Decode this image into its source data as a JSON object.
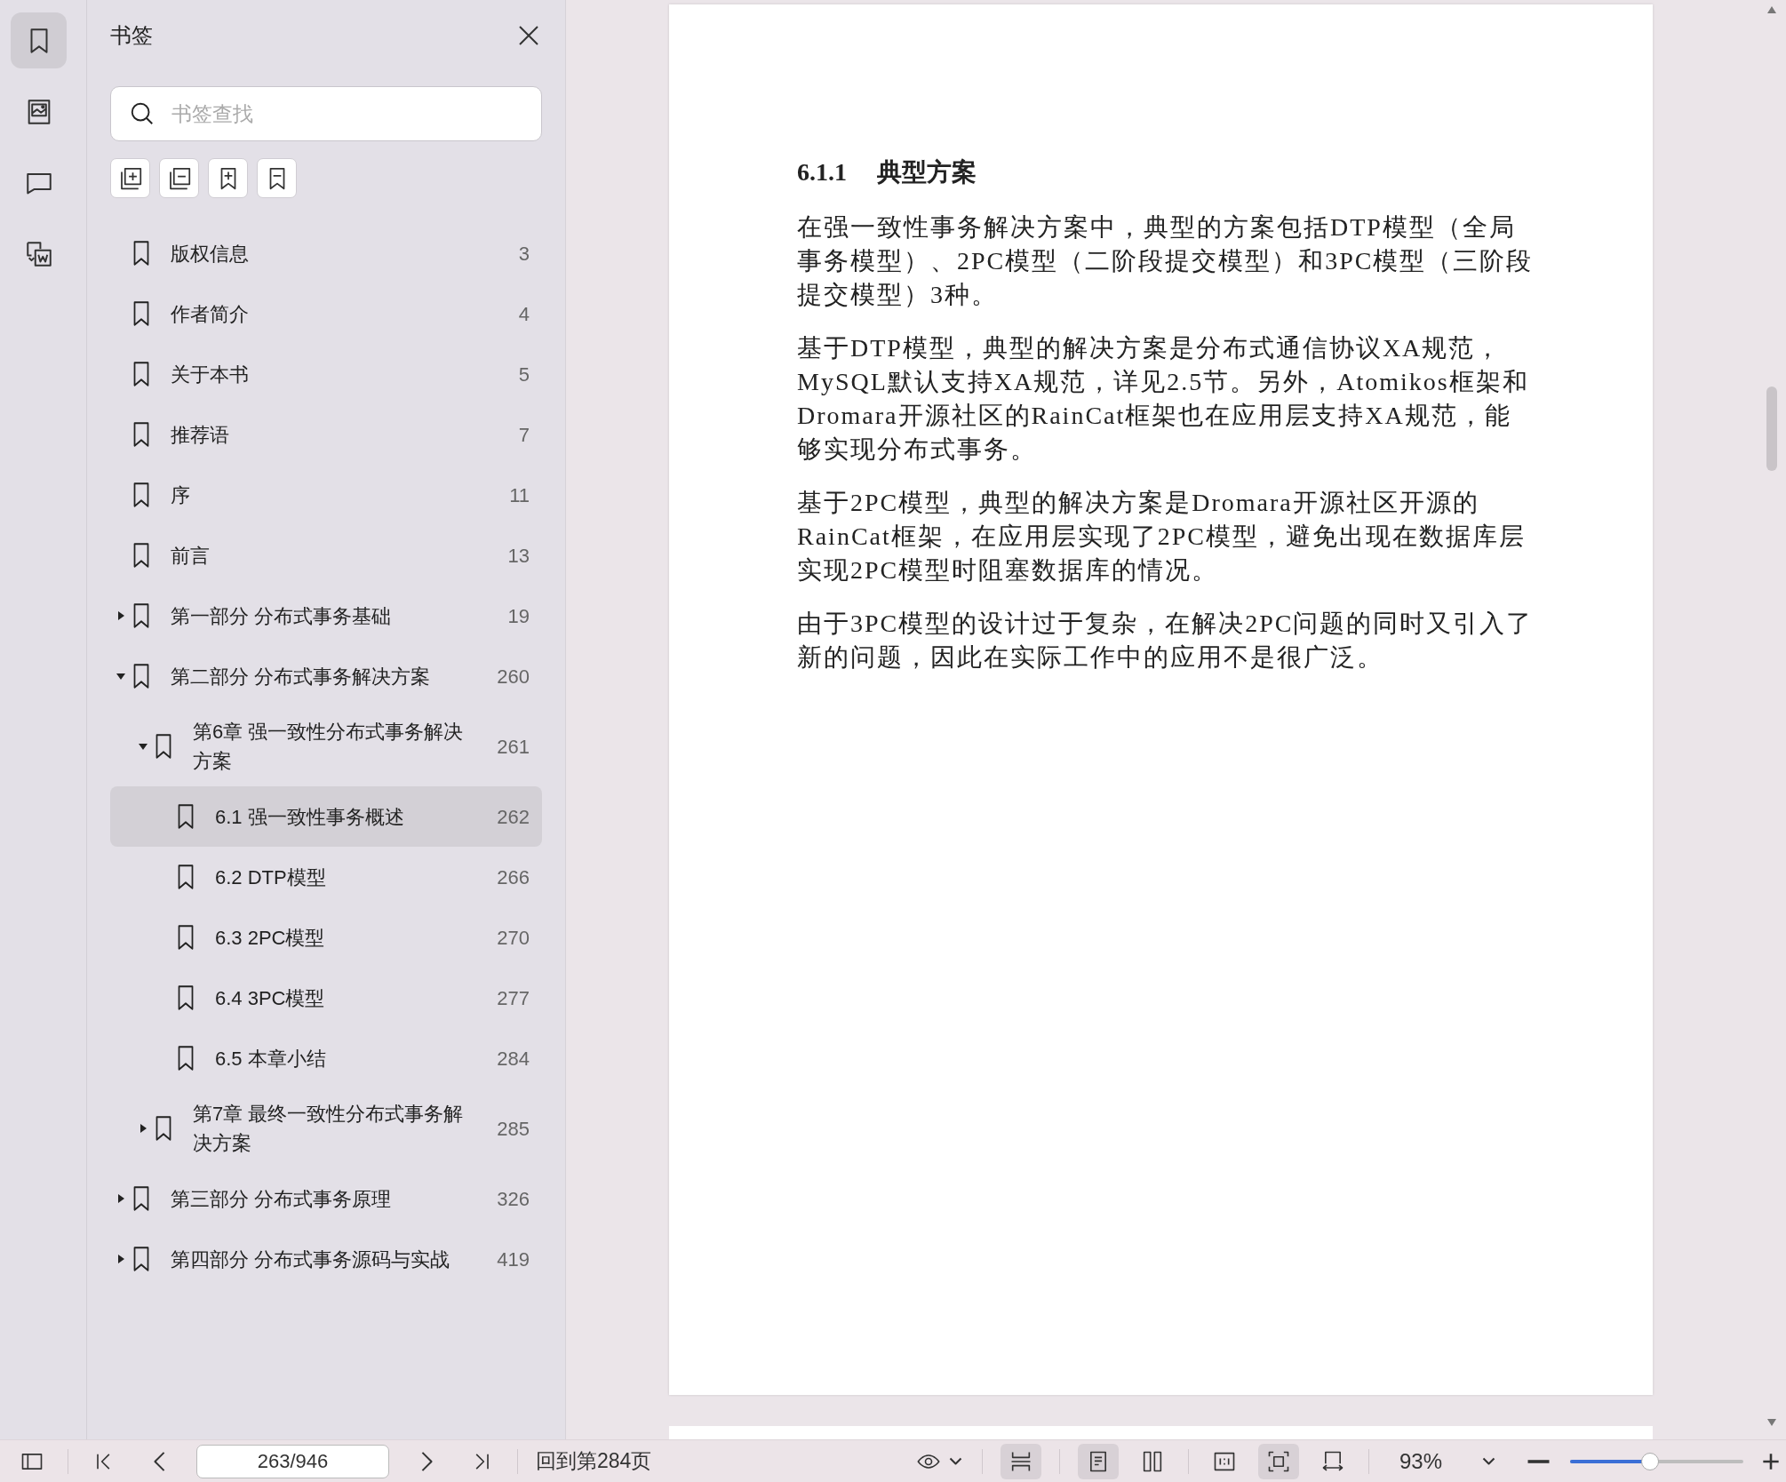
{
  "rail": [
    {
      "kind": "bookmark",
      "selected": true
    },
    {
      "kind": "image",
      "selected": false
    },
    {
      "kind": "comment",
      "selected": false
    },
    {
      "kind": "convert",
      "selected": false
    }
  ],
  "panel": {
    "title": "书签",
    "search": {
      "placeholder": "书签查找"
    },
    "tools": [
      {
        "kind": "expand-all"
      },
      {
        "kind": "collapse-all"
      },
      {
        "kind": "add-bookmark"
      },
      {
        "kind": "remove-bookmark"
      }
    ]
  },
  "bookmarks": [
    {
      "label": "版权信息",
      "page": "3",
      "selected": false
    },
    {
      "label": "作者简介",
      "page": "4",
      "selected": false
    },
    {
      "label": "关于本书",
      "page": "5",
      "selected": false
    },
    {
      "label": "推荐语",
      "page": "7",
      "selected": false
    },
    {
      "label": "序",
      "page": "11",
      "selected": false
    },
    {
      "label": "前言",
      "page": "13",
      "selected": false
    },
    {
      "label": "第一部分 分布式事务基础",
      "page": "19",
      "selected": false,
      "expanded": false
    },
    {
      "label": "第二部分 分布式事务解决方案",
      "page": "260",
      "selected": false,
      "expanded": true,
      "children": [
        {
          "label": "第6章 强一致性分布式事务解决方案",
          "page": "261",
          "selected": false,
          "expanded": true,
          "children": [
            {
              "label": "6.1 强一致性事务概述",
              "page": "262",
              "selected": true
            },
            {
              "label": "6.2 DTP模型",
              "page": "266",
              "selected": false
            },
            {
              "label": "6.3 2PC模型",
              "page": "270",
              "selected": false
            },
            {
              "label": "6.4 3PC模型",
              "page": "277",
              "selected": false
            },
            {
              "label": "6.5 本章小结",
              "page": "284",
              "selected": false
            }
          ]
        },
        {
          "label": "第7章 最终一致性分布式事务解决方案",
          "page": "285",
          "selected": false,
          "expanded": false
        }
      ]
    },
    {
      "label": "第三部分 分布式事务原理",
      "page": "326",
      "selected": false,
      "expanded": false
    },
    {
      "label": "第四部分 分布式事务源码与实战",
      "page": "419",
      "selected": false,
      "expanded": false
    }
  ],
  "document": {
    "section_number": "6.1.1",
    "section_title": "典型方案",
    "paragraphs": [
      "在强一致性事务解决方案中，典型的方案包括DTP模型（全局事务模型）、2PC模型（二阶段提交模型）和3PC模型（三阶段提交模型）3种。",
      "基于DTP模型，典型的解决方案是分布式通信协议XA规范，MySQL默认支持XA规范，详见2.5节。另外，Atomikos框架和Dromara开源社区的RainCat框架也在应用层支持XA规范，能够实现分布式事务。",
      "基于2PC模型，典型的解决方案是Dromara开源社区开源的RainCat框架，在应用层实现了2PC模型，避免出现在数据库层实现2PC模型时阻塞数据库的情况。",
      "由于3PC模型的设计过于复杂，在解决2PC问题的同时又引入了新的问题，因此在实际工作中的应用不是很广泛。"
    ]
  },
  "toolbar": {
    "page_field": "263/946",
    "goto_label": "回到第284页",
    "view_groups": [
      [
        {
          "kind": "continuous",
          "on": true
        }
      ],
      [
        {
          "kind": "single-page",
          "on": true
        },
        {
          "kind": "two-page",
          "on": false
        }
      ],
      [
        {
          "kind": "actual-size",
          "on": false
        },
        {
          "kind": "fit-page",
          "on": true
        },
        {
          "kind": "fit-width",
          "on": false
        }
      ]
    ],
    "zoom": "93%",
    "zoom_slider": {
      "level": 0.46
    }
  }
}
